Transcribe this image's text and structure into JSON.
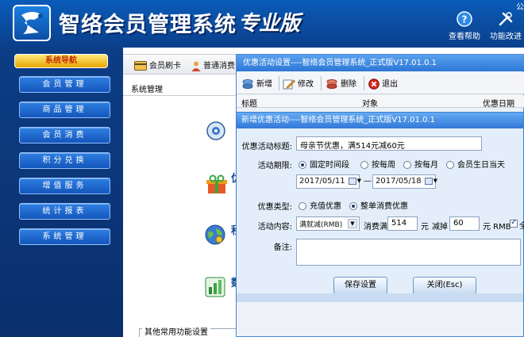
{
  "app": {
    "title": "智络会员管理系统",
    "edition": "专业版",
    "corner_text": "公",
    "tools": [
      {
        "label": "查看帮助",
        "icon": "help-icon"
      },
      {
        "label": "功能改进",
        "icon": "tools-icon"
      }
    ]
  },
  "nav": {
    "header": "系统导航",
    "items": [
      "会员管理",
      "商品管理",
      "会员消费",
      "积分兑换",
      "增值服务",
      "统计报表",
      "系统管理"
    ]
  },
  "main": {
    "toolbar": [
      {
        "label": "会员刷卡",
        "icon": "card-icon"
      },
      {
        "label": "普通消费",
        "icon": "person-icon"
      }
    ],
    "breadcrumb": "系统管理",
    "feature_letters": [
      "优",
      "积",
      "数"
    ],
    "other_section": "其他常用功能设置"
  },
  "list_window": {
    "title": "优惠活动设置----智络会员管理系统_正式版V17.01.0.1",
    "buttons": [
      {
        "label": "新增",
        "icon": "add-icon"
      },
      {
        "label": "修改",
        "icon": "edit-icon"
      },
      {
        "label": "删除",
        "icon": "delete-icon"
      },
      {
        "label": "退出",
        "icon": "exit-icon"
      }
    ],
    "columns": [
      "标题",
      "对象",
      "优惠日期"
    ]
  },
  "dialog": {
    "title": "新增优惠活动----智络会员管理系统_正式版V17.01.0.1",
    "title_label": "优惠活动标题:",
    "title_value": "母亲节优惠，满514元减60元",
    "period_label": "活动期限:",
    "period_options": [
      {
        "label": "固定时间段",
        "selected": true
      },
      {
        "label": "按每周",
        "selected": false
      },
      {
        "label": "按每月",
        "selected": false
      },
      {
        "label": "会员生日当天",
        "selected": false
      }
    ],
    "date_start": "2017/05/11",
    "date_sep": "—",
    "date_end": "2017/05/18",
    "type_label": "优惠类型:",
    "type_options": [
      {
        "label": "充值优惠",
        "selected": false
      },
      {
        "label": "整单消费优惠",
        "selected": true
      }
    ],
    "content_label": "活动内容:",
    "content_select": "满就减(RMB)",
    "spend_label": "消费满",
    "spend_value": "514",
    "unit1": "元",
    "deduct_label": "减掉",
    "deduct_value": "60",
    "unit2": "元 RMB",
    "extra_text": "全",
    "remark_label": "备注:",
    "save_label": "保存设置",
    "close_label": "关闭(Esc)"
  },
  "colors": {
    "header_blue": "#0b4c9f",
    "nav_button": "#1f67cf",
    "nav_header_gold": "#f2b800",
    "dialog_bg": "#e3eefa"
  }
}
